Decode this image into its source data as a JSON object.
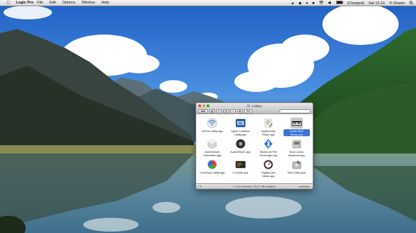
{
  "menubar": {
    "apple_glyph": "",
    "app_name": "Logic Pro",
    "menus": [
      "File",
      "Edit",
      "Options",
      "Window",
      "Help"
    ],
    "battery_status": "(Charged)",
    "clock": "Sat 12:10",
    "user": "Yi Shawn",
    "status_glyphs": [
      "▲",
      "◆",
      "●",
      "■"
    ]
  },
  "finder": {
    "title": "Utilities",
    "search_placeholder": "",
    "status_text": "1 of 31 selected, 25.47 GB available",
    "traffic_colors": [
      "#e0443e",
      "#dea123",
      "#28a93a"
    ],
    "apps": [
      {
        "name": "AirPort Utility.app",
        "icon": "airport-wifi-icon"
      },
      {
        "name": "Apple Lossless Utility.app",
        "icon": "apple-lossless-icon"
      },
      {
        "name": "AppleScript Editor.app",
        "icon": "applescript-scroll-icon"
      },
      {
        "name": "Audio MIDI Setup.app",
        "icon": "midi-keyboard-icon",
        "selected": true
      },
      {
        "name": "AudioHelper Uninstaller.app",
        "icon": "uninstaller-icon"
      },
      {
        "name": "AudioHelper.app",
        "icon": "audiohelper-icon"
      },
      {
        "name": "Bluetooth File Exchange.app",
        "icon": "bluetooth-icon"
      },
      {
        "name": "Boot Camp Assistant.app",
        "icon": "bootcamp-disk-icon"
      },
      {
        "name": "ColorSync Utility.app",
        "icon": "colorsync-icon"
      },
      {
        "name": "Console.app",
        "icon": "console-icon"
      },
      {
        "name": "DigitalColor Meter.app",
        "icon": "color-meter-icon"
      },
      {
        "name": "Disk Utility.app",
        "icon": "disk-utility-icon"
      }
    ]
  }
}
